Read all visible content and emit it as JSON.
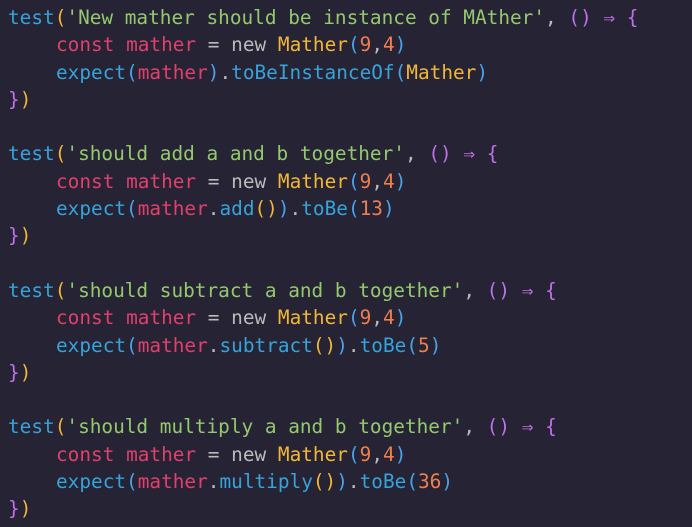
{
  "code": {
    "blocks": [
      {
        "test_fn": "test",
        "description": "'New mather should be instance of MAther'",
        "const_kw": "const",
        "var_name": "mather",
        "assign": "=",
        "new_kw": "new",
        "class_name": "Mather",
        "arg_a": "9",
        "arg_b": "4",
        "expect_fn": "expect",
        "expect_subject": "mather",
        "method": "",
        "matcher": "toBeInstanceOf",
        "matcher_arg": "Mather",
        "matcher_arg_type": "class"
      },
      {
        "test_fn": "test",
        "description": "'should add a and b together'",
        "const_kw": "const",
        "var_name": "mather",
        "assign": "=",
        "new_kw": "new",
        "class_name": "Mather",
        "arg_a": "9",
        "arg_b": "4",
        "expect_fn": "expect",
        "expect_subject": "mather",
        "method": "add",
        "matcher": "toBe",
        "matcher_arg": "13",
        "matcher_arg_type": "number"
      },
      {
        "test_fn": "test",
        "description": "'should subtract a and b together'",
        "const_kw": "const",
        "var_name": "mather",
        "assign": "=",
        "new_kw": "new",
        "class_name": "Mather",
        "arg_a": "9",
        "arg_b": "4",
        "expect_fn": "expect",
        "expect_subject": "mather",
        "method": "subtract",
        "matcher": "toBe",
        "matcher_arg": "5",
        "matcher_arg_type": "number"
      },
      {
        "test_fn": "test",
        "description": "'should multiply a and b together'",
        "const_kw": "const",
        "var_name": "mather",
        "assign": "=",
        "new_kw": "new",
        "class_name": "Mather",
        "arg_a": "9",
        "arg_b": "4",
        "expect_fn": "expect",
        "expect_subject": "mather",
        "method": "multiply",
        "matcher": "toBe",
        "matcher_arg": "36",
        "matcher_arg_type": "number"
      }
    ]
  },
  "colors": {
    "background": "#262335",
    "function": "#36a3d9",
    "string": "#95c96e",
    "keyword": "#e0406c",
    "class": "#f3b736",
    "number": "#f07f4e",
    "bracket_outer": "#f3b736",
    "bracket_mid": "#c070e8",
    "bracket_inner": "#4aa3e8",
    "text": "#bbbbbb"
  }
}
